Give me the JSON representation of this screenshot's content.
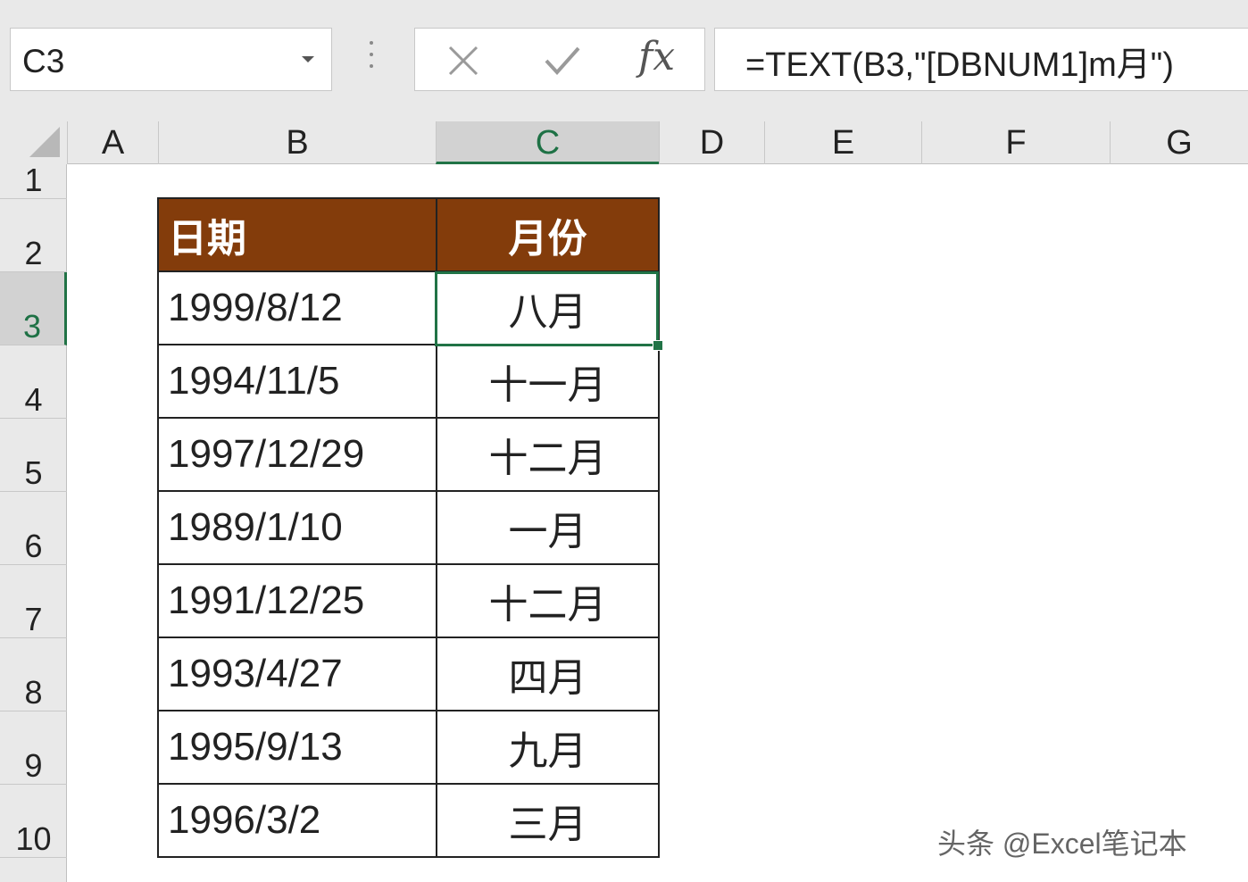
{
  "name_box": {
    "value": "C3"
  },
  "formula_bar": {
    "formula": "=TEXT(B3,\"[DBNUM1]m月\")",
    "fx_label": "fx"
  },
  "columns": [
    "A",
    "B",
    "C",
    "D",
    "E",
    "F",
    "G"
  ],
  "active_column": "C",
  "rows": [
    "1",
    "2",
    "3",
    "4",
    "5",
    "6",
    "7",
    "8",
    "9",
    "10"
  ],
  "active_row": "3",
  "table": {
    "headers": [
      "日期",
      "月份"
    ],
    "rows": [
      [
        "1999/8/12",
        "八月"
      ],
      [
        "1994/11/5",
        "十一月"
      ],
      [
        "1997/12/29",
        "十二月"
      ],
      [
        "1989/1/10",
        "一月"
      ],
      [
        "1991/12/25",
        "十二月"
      ],
      [
        "1993/4/27",
        "四月"
      ],
      [
        "1995/9/13",
        "九月"
      ],
      [
        "1996/3/2",
        "三月"
      ]
    ],
    "header_color": "#833c0b",
    "selection_color": "#217346"
  },
  "watermark": "头条 @Excel笔记本"
}
